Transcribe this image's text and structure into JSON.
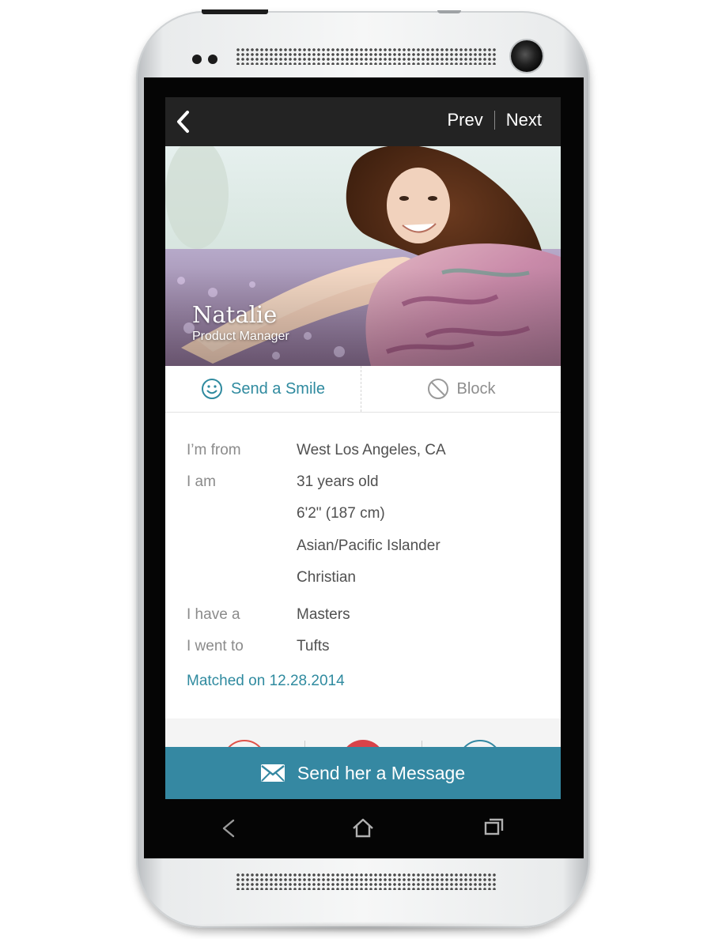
{
  "topbar": {
    "prev_label": "Prev",
    "next_label": "Next"
  },
  "profile": {
    "name": "Natalie",
    "title": "Product Manager"
  },
  "actions": {
    "smile_label": "Send a Smile",
    "block_label": "Block"
  },
  "details": {
    "from_label": "I’m from",
    "from_value": "West Los Angeles, CA",
    "am_label": "I am",
    "am_values": [
      "31 years old",
      "6'2\" (187 cm)",
      "Asian/Pacific Islander",
      "Christian"
    ],
    "have_label": "I have a",
    "have_value": "Masters",
    "went_label": "I went to",
    "went_value": "Tufts"
  },
  "matched": "Matched on 12.28.2014",
  "message_button": "Send her a Message",
  "colors": {
    "accent": "#2f8a9f",
    "message_bar": "#3588a2",
    "topbar": "#232323"
  }
}
